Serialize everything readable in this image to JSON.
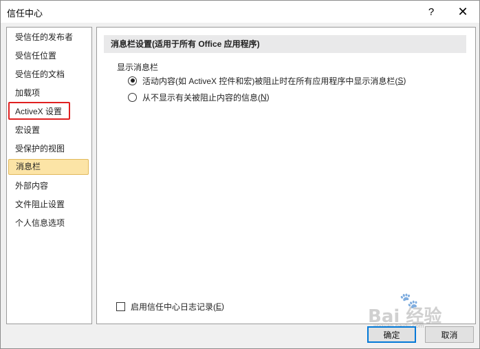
{
  "window": {
    "title": "信任中心",
    "help_label": "?",
    "close_label": "✕"
  },
  "sidebar": {
    "items": [
      {
        "label": "受信任的发布者"
      },
      {
        "label": "受信任位置"
      },
      {
        "label": "受信任的文档"
      },
      {
        "label": "加载项"
      },
      {
        "label": "ActiveX 设置"
      },
      {
        "label": "宏设置"
      },
      {
        "label": "受保护的视图"
      },
      {
        "label": "消息栏"
      },
      {
        "label": "外部内容"
      },
      {
        "label": "文件阻止设置"
      },
      {
        "label": "个人信息选项"
      }
    ],
    "selected": "消息栏",
    "annotated": "ActiveX 设置"
  },
  "main": {
    "section_title": "消息栏设置(适用于所有 Office 应用程序)",
    "group_label": "显示消息栏",
    "radio_options": [
      {
        "label_main": "活动内容(如 ActiveX 控件和宏)被阻止时在所有应用程序中显示消息栏(",
        "key": "S",
        "label_end": ")",
        "checked": true
      },
      {
        "label_main": "从不显示有关被阻止内容的信息(",
        "key": "N",
        "label_end": ")",
        "checked": false
      }
    ],
    "checkbox": {
      "label_main": "启用信任中心日志记录(",
      "key": "E",
      "label_end": ")",
      "checked": false
    }
  },
  "footer": {
    "ok_label": "确定",
    "cancel_label": "取消"
  },
  "watermark": {
    "text": "Bai 经验",
    "url": "jingyan.baidu.com"
  },
  "colors": {
    "selected_bg": "#fce4a6",
    "selected_border": "#e1b85a",
    "highlight_red": "#e02020",
    "primary_border": "#0078d7"
  }
}
